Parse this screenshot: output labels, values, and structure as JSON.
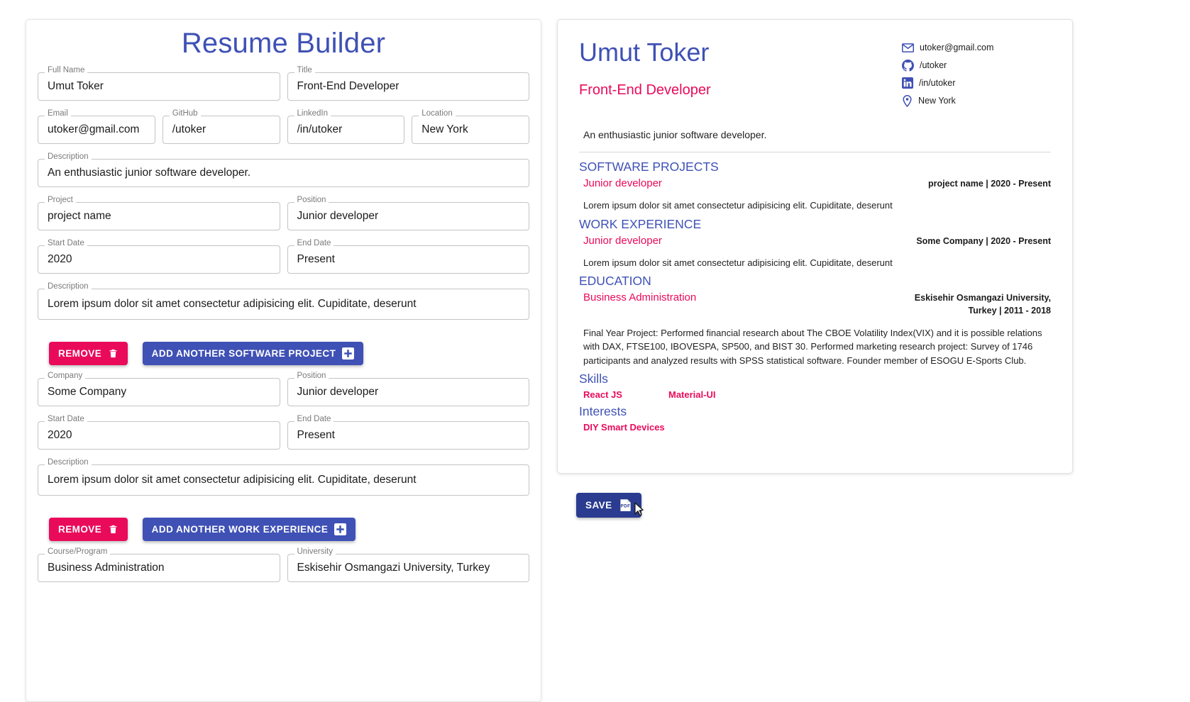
{
  "app": {
    "title": "Resume Builder"
  },
  "form": {
    "fields": [
      {
        "label": "Full Name",
        "value": "Umut Toker"
      },
      {
        "label": "Title",
        "value": "Front-End Developer"
      },
      {
        "label": "Email",
        "value": "utoker@gmail.com"
      },
      {
        "label": "GitHub",
        "value": "/utoker"
      },
      {
        "label": "LinkedIn",
        "value": "/in/utoker"
      },
      {
        "label": "Location",
        "value": "New York"
      },
      {
        "label": "Description",
        "value": "An enthusiastic junior software developer."
      },
      {
        "label": "Project",
        "value": "project name"
      },
      {
        "label": "Position",
        "value": "Junior developer"
      },
      {
        "label": "Start Date",
        "value": "2020"
      },
      {
        "label": "End Date",
        "value": "Present"
      },
      {
        "label": "Description",
        "value": "Lorem ipsum dolor sit amet consectetur adipisicing elit. Cupiditate, deserunt"
      },
      {
        "label": "Company",
        "value": "Some Company"
      },
      {
        "label": "Position",
        "value": "Junior developer"
      },
      {
        "label": "Start Date",
        "value": "2020"
      },
      {
        "label": "End Date",
        "value": "Present"
      },
      {
        "label": "Description",
        "value": "Lorem ipsum dolor sit amet consectetur adipisicing elit. Cupiditate, deserunt"
      },
      {
        "label": "Course/Program",
        "value": "Business Administration"
      },
      {
        "label": "University",
        "value": "Eskisehir Osmangazi University, Turkey"
      }
    ],
    "buttons": {
      "remove": "REMOVE",
      "add_project": "ADD ANOTHER SOFTWARE PROJECT",
      "add_work": "ADD ANOTHER WORK EXPERIENCE"
    }
  },
  "resume": {
    "name": "Umut Toker",
    "title": "Front-End Developer",
    "description": "An enthusiastic junior software developer.",
    "contacts": [
      {
        "icon": "email-icon",
        "value": "utoker@gmail.com"
      },
      {
        "icon": "github-icon",
        "value": "/utoker"
      },
      {
        "icon": "linkedin-icon",
        "value": "/in/utoker"
      },
      {
        "icon": "location-pin-icon",
        "value": "New York"
      }
    ],
    "projects": {
      "heading": "SOFTWARE PROJECTS",
      "entry_title": "Junior developer",
      "entry_meta": "project name | 2020 - Present",
      "entry_desc": "Lorem ipsum dolor sit amet consectetur adipisicing elit. Cupiditate, deserunt"
    },
    "work": {
      "heading": "WORK EXPERIENCE",
      "entry_title": "Junior developer",
      "entry_meta": "Some Company | 2020 - Present",
      "entry_desc": "Lorem ipsum dolor sit amet consectetur adipisicing elit. Cupiditate, deserunt"
    },
    "education": {
      "heading": "EDUCATION",
      "entry_title": "Business Administration",
      "entry_meta": "Eskisehir Osmangazi University, Turkey | 2011 - 2018",
      "entry_desc": "Final Year Project: Performed financial research about The CBOE Volatility Index(VIX) and it is possible relations with DAX, FTSE100, IBOVESPA, SP500, and BIST 30. Performed marketing research project: Survey of 1746 participants and analyzed results with SPSS statistical software. Founder member of ESOGU E-Sports Club."
    },
    "skills": {
      "heading": "Skills",
      "items": [
        "React JS",
        "Material-UI"
      ]
    },
    "interests": {
      "heading": "Interests",
      "items": [
        "DIY Smart Devices"
      ]
    }
  },
  "save_button": {
    "label": "SAVE"
  },
  "colors": {
    "primary": "#3f51b5",
    "accent": "#ea0a5a",
    "save": "#2a3b90"
  }
}
